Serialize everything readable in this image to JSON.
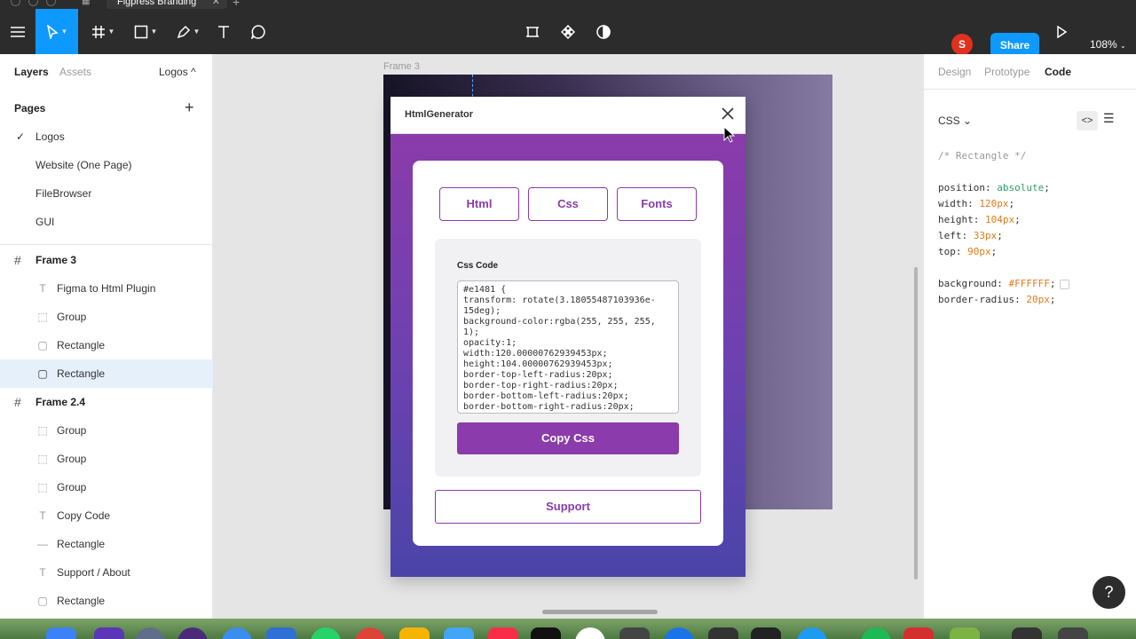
{
  "tab": {
    "title": "Figpress Branding",
    "close": "✕",
    "add": "+"
  },
  "toolbar": {
    "avatar_initial": "S",
    "share_label": "Share",
    "zoom": "108%"
  },
  "left_panel": {
    "tabs": {
      "layers": "Layers",
      "assets": "Assets",
      "page_select": "Logos ^"
    },
    "pages_title": "Pages",
    "add": "+",
    "pages": [
      "Logos",
      "Website (One Page)",
      "FileBrowser",
      "GUI"
    ],
    "frame3": {
      "label": "Frame 3",
      "children": [
        "Figma to Html Plugin",
        "Group",
        "Rectangle",
        "Rectangle"
      ]
    },
    "frame24": {
      "label": "Frame 2.4",
      "children": [
        "Group",
        "Group",
        "Group",
        "Copy Code",
        "Rectangle",
        "Support / About",
        "Rectangle"
      ]
    }
  },
  "canvas": {
    "frame_label": "Frame 3"
  },
  "plugin": {
    "title": "HtmlGenerator",
    "tabs": [
      "Html",
      "Css",
      "Fonts"
    ],
    "code_label": "Css Code",
    "code": "#e1481 {\ntransform: rotate(3.18055487103936e-15deg);\nbackground-color:rgba(255, 255, 255, 1);\nopacity:1;\nwidth:120.00000762939453px;\nheight:104.00000762939453px;\nborder-top-left-radius:20px;\nborder-top-right-radius:20px;\nborder-bottom-left-radius:20px;\nborder-bottom-right-radius:20px;",
    "copy_label": "Copy Css",
    "support_label": "Support"
  },
  "right_panel": {
    "tabs": {
      "design": "Design",
      "prototype": "Prototype",
      "code": "Code"
    },
    "lang": "CSS ⌄",
    "comment": "/* Rectangle */",
    "props": [
      {
        "k": "position",
        "v": "absolute",
        "c": "#2f9e6b"
      },
      {
        "k": "width",
        "v": "120px",
        "c": "#e07b18"
      },
      {
        "k": "height",
        "v": "104px",
        "c": "#e07b18"
      },
      {
        "k": "left",
        "v": "33px",
        "c": "#e07b18"
      },
      {
        "k": "top",
        "v": "90px",
        "c": "#e07b18"
      }
    ],
    "props2": [
      {
        "k": "background",
        "v": "#FFFFFF",
        "c": "#e07b18"
      },
      {
        "k": "border-radius",
        "v": "20px",
        "c": "#e07b18"
      }
    ]
  },
  "help": "?",
  "colors": {
    "accent": "#0d99ff",
    "plugin_purple": "#8b3bab"
  }
}
